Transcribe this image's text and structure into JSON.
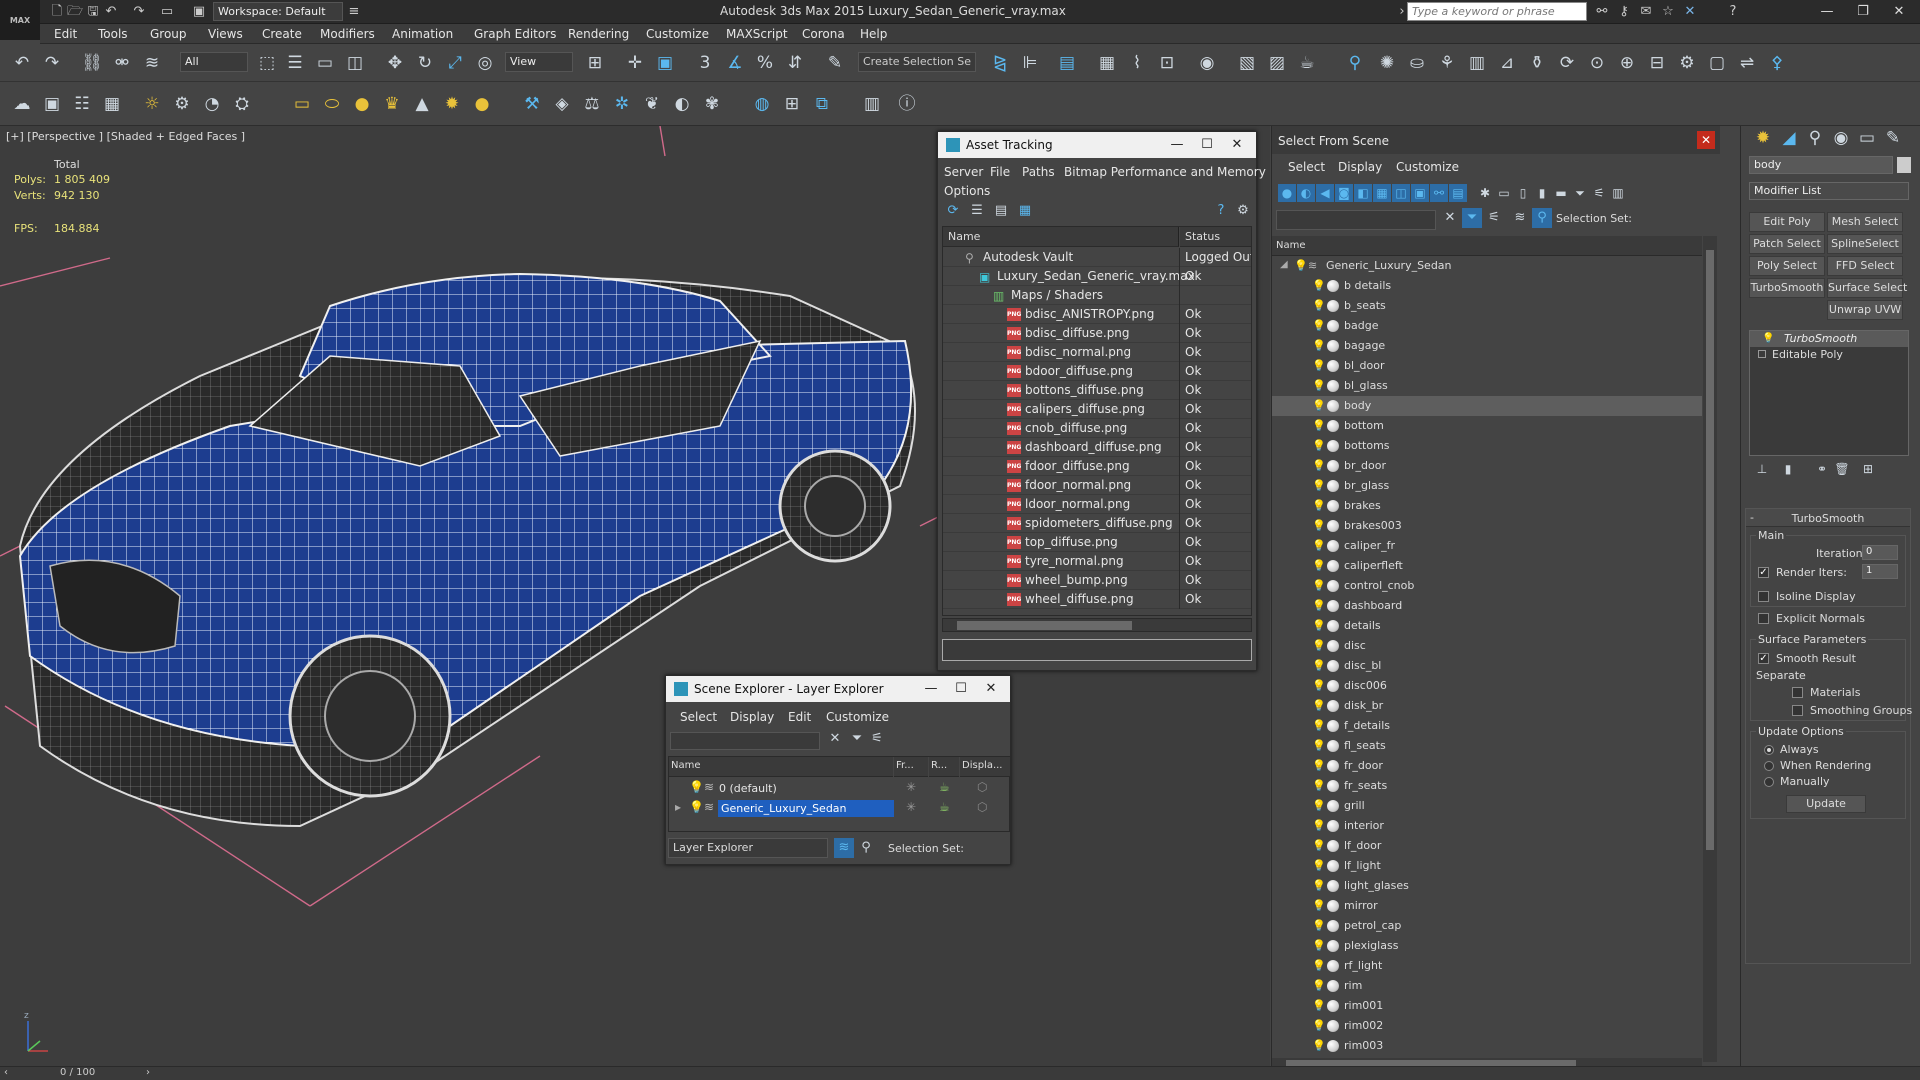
{
  "app": {
    "logo": "MAX",
    "workspace": "Workspace: Default",
    "title": "Autodesk 3ds Max  2015     Luxury_Sedan_Generic_vray.max",
    "search_placeholder": "Type a keyword or phrase"
  },
  "menu": [
    "Edit",
    "Tools",
    "Group",
    "Views",
    "Create",
    "Modifiers",
    "Animation",
    "Graph Editors",
    "Rendering",
    "Customize",
    "MAXScript",
    "Corona",
    "Help"
  ],
  "toolbar": {
    "filter_value": "All",
    "view_value": "View",
    "snap_label": "3",
    "selection_set_placeholder": "Create Selection Se"
  },
  "viewport": {
    "label": "[+] [Perspective ] [Shaded + Edged Faces ]",
    "stats": {
      "total_label": "Total",
      "polys_label": "Polys:",
      "polys_value": "1 805 409",
      "verts_label": "Verts:",
      "verts_value": "942 130",
      "fps_label": "FPS:",
      "fps_value": "184.884"
    }
  },
  "asset_tracking": {
    "title": "Asset Tracking",
    "menu": [
      "Server",
      "File",
      "Paths",
      "Bitmap Performance and Memory",
      "Options"
    ],
    "columns": [
      "Name",
      "Status"
    ],
    "vault": {
      "name": "Autodesk Vault",
      "status": "Logged Out ."
    },
    "file": {
      "name": "Luxury_Sedan_Generic_vray.max",
      "status": "Ok"
    },
    "group": "Maps / Shaders",
    "maps": [
      {
        "name": "bdisc_ANISTROPY.png",
        "status": "Ok"
      },
      {
        "name": "bdisc_diffuse.png",
        "status": "Ok"
      },
      {
        "name": "bdisc_normal.png",
        "status": "Ok"
      },
      {
        "name": "bdoor_diffuse.png",
        "status": "Ok"
      },
      {
        "name": "bottons_diffuse.png",
        "status": "Ok"
      },
      {
        "name": "calipers_diffuse.png",
        "status": "Ok"
      },
      {
        "name": "cnob_diffuse.png",
        "status": "Ok"
      },
      {
        "name": "dashboard_diffuse.png",
        "status": "Ok"
      },
      {
        "name": "fdoor_diffuse.png",
        "status": "Ok"
      },
      {
        "name": "fdoor_normal.png",
        "status": "Ok"
      },
      {
        "name": "ldoor_normal.png",
        "status": "Ok"
      },
      {
        "name": "spidometers_diffuse.png",
        "status": "Ok"
      },
      {
        "name": "top_diffuse.png",
        "status": "Ok"
      },
      {
        "name": "tyre_normal.png",
        "status": "Ok"
      },
      {
        "name": "wheel_bump.png",
        "status": "Ok"
      },
      {
        "name": "wheel_diffuse.png",
        "status": "Ok"
      }
    ]
  },
  "scene_explorer": {
    "title": "Scene Explorer - Layer Explorer",
    "menu": [
      "Select",
      "Display",
      "Edit",
      "Customize"
    ],
    "columns": [
      "Name",
      "Fr...",
      "R...",
      "Displa..."
    ],
    "layers": [
      "0 (default)",
      "Generic_Luxury_Sedan"
    ],
    "mode": "Layer Explorer",
    "selection_set_label": "Selection Set:"
  },
  "select_from_scene": {
    "title": "Select From Scene",
    "menu": [
      "Select",
      "Display",
      "Customize"
    ],
    "selection_set_label": "Selection Set:",
    "column": "Name",
    "root": "Generic_Luxury_Sedan",
    "selected": "body",
    "objects": [
      "b details",
      "b_seats",
      "badge",
      "bagage",
      "bl_door",
      "bl_glass",
      "body",
      "bottom",
      "bottoms",
      "br_door",
      "br_glass",
      "brakes",
      "brakes003",
      "caliper_fr",
      "caliperfleft",
      "control_cnob",
      "dashboard",
      "details",
      "disc",
      "disc_bl",
      "disc006",
      "disk_br",
      "f_details",
      "fl_seats",
      "fr_door",
      "fr_seats",
      "grill",
      "interior",
      "lf_door",
      "lf_light",
      "light_glases",
      "mirror",
      "petrol_cap",
      "plexiglass",
      "rf_light",
      "rim",
      "rim001",
      "rim002",
      "rim003"
    ]
  },
  "command_panel": {
    "object_name": "body",
    "modifier_list": "Modifier List",
    "buttons": [
      "Edit Poly",
      "Mesh Select",
      "Patch Select",
      "SplineSelect",
      "Poly Select",
      "FFD Select",
      "TurboSmooth",
      "Surface Select",
      "Unwrap UVW"
    ],
    "stack": [
      "TurboSmooth",
      "Editable Poly"
    ],
    "rollout_title": "TurboSmooth",
    "main_label": "Main",
    "iterations_label": "Iterations:",
    "iterations_value": "0",
    "render_iters_label": "Render Iters:",
    "render_iters_value": "1",
    "isoline_label": "Isoline Display",
    "explicit_normals_label": "Explicit Normals",
    "surface_params_label": "Surface Parameters",
    "smooth_result_label": "Smooth Result",
    "separate_label": "Separate",
    "materials_label": "Materials",
    "smoothing_groups_label": "Smoothing Groups",
    "update_options_label": "Update Options",
    "always_label": "Always",
    "when_rendering_label": "When Rendering",
    "manually_label": "Manually",
    "update_button": "Update"
  },
  "status": {
    "timeline": "0 / 100"
  },
  "colors": {
    "accent": "#2d94b8",
    "selection": "#1f5fbf",
    "car_body": "#1d3d8f"
  }
}
